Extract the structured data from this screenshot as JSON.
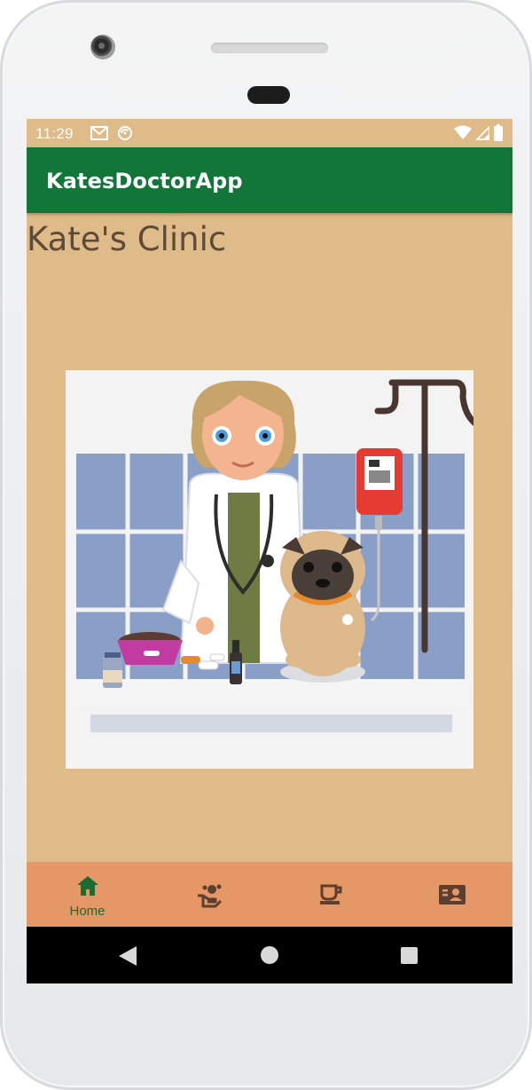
{
  "status_bar": {
    "time": "11:29",
    "icons_left": [
      "gmail-icon",
      "sync-icon"
    ],
    "icons_right": [
      "wifi-icon",
      "cell-signal-icon",
      "battery-icon"
    ]
  },
  "app_bar": {
    "title": "KatesDoctorApp",
    "color": "#137639"
  },
  "main": {
    "title": "Kate's Clinic",
    "background": "#debb89",
    "image": "vet-clinic-illustration"
  },
  "bottom_nav": {
    "background": "#e59765",
    "items": [
      {
        "label": "Home",
        "icon": "home-icon",
        "active": true
      },
      {
        "label": "",
        "icon": "hand-care-icon",
        "active": false
      },
      {
        "label": "",
        "icon": "coffee-cup-icon",
        "active": false
      },
      {
        "label": "",
        "icon": "contact-card-icon",
        "active": false
      }
    ]
  },
  "system_nav": {
    "buttons": [
      "back-icon",
      "home-circle-icon",
      "recents-icon"
    ]
  }
}
